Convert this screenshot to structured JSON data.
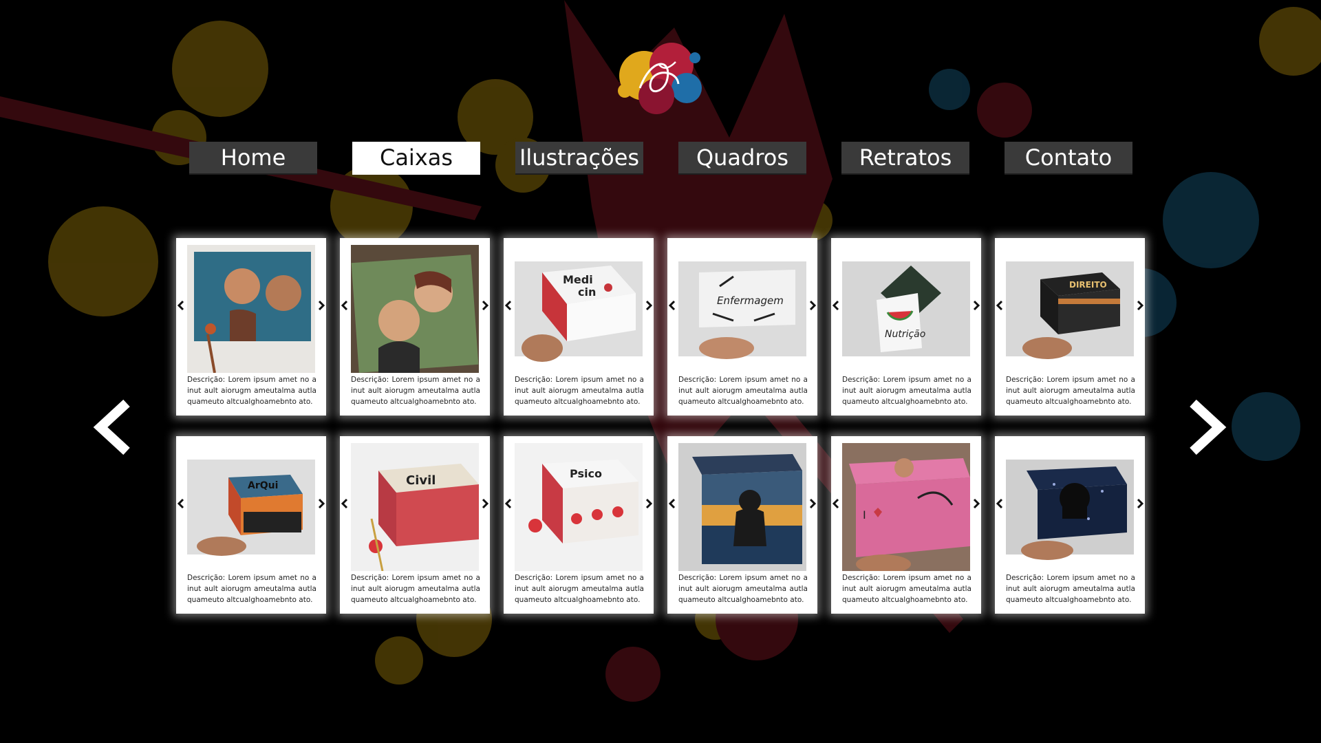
{
  "brand": {
    "logo_icon": "paint-splash-signature-logo"
  },
  "nav": {
    "items": [
      {
        "label": "Home",
        "active": false
      },
      {
        "label": "Caixas",
        "active": true
      },
      {
        "label": "Ilustrações",
        "active": false
      },
      {
        "label": "Quadros",
        "active": false
      },
      {
        "label": "Retratos",
        "active": false
      },
      {
        "label": "Contato",
        "active": false
      }
    ]
  },
  "gallery": {
    "cards": [
      {
        "image": "couple-portrait-box-photo",
        "description": "Descrição: Lorem ipsum amet no a inut ault aiorugm ameutalma autla quameuto altcualghoamebnto ato."
      },
      {
        "image": "elderly-couple-portrait-box-photo",
        "description": "Descrição: Lorem ipsum amet no a inut ault aiorugm ameutalma autla quameuto altcualghoamebnto ato."
      },
      {
        "image": "medicina-box-photo",
        "description": "Descrição: Lorem ipsum amet no a inut ault aiorugm ameutalma autla quameuto altcualghoamebnto ato."
      },
      {
        "image": "enfermagem-box-photo",
        "description": "Descrição: Lorem ipsum amet no a inut ault aiorugm ameutalma autla quameuto altcualghoamebnto ato."
      },
      {
        "image": "nutricao-box-photo",
        "description": "Descrição: Lorem ipsum amet no a inut ault aiorugm ameutalma autla quameuto altcualghoamebnto ato."
      },
      {
        "image": "direito-box-photo",
        "description": "Descrição: Lorem ipsum amet no a inut ault aiorugm ameutalma autla quameuto altcualghoamebnto ato."
      },
      {
        "image": "arquitetura-box-photo",
        "description": "Descrição: Lorem ipsum amet no a inut ault aiorugm ameutalma autla quameuto altcualghoamebnto ato."
      },
      {
        "image": "civil-box-photo",
        "description": "Descrição: Lorem ipsum amet no a inut ault aiorugm ameutalma autla quameuto altcualghoamebnto ato."
      },
      {
        "image": "psicologia-box-photo",
        "description": "Descrição: Lorem ipsum amet no a inut ault aiorugm ameutalma autla quameuto altcualghoamebnto ato."
      },
      {
        "image": "sunset-couple-box-photo",
        "description": "Descrição: Lorem ipsum amet no a inut ault aiorugm ameutalma autla quameuto altcualghoamebnto ato."
      },
      {
        "image": "pink-portrait-box-photo",
        "description": "Descrição: Lorem ipsum amet no a inut ault aiorugm ameutalma autla quameuto altcualghoamebnto ato."
      },
      {
        "image": "darth-vader-box-photo",
        "description": "Descrição: Lorem ipsum amet no a inut ault aiorugm ameutalma autla quameuto altcualghoamebnto ato."
      }
    ]
  },
  "icons": {
    "carousel_prev": "chevron-left-icon",
    "carousel_next": "chevron-right-icon",
    "card_prev": "small-chevron-left-icon",
    "card_next": "small-chevron-right-icon"
  },
  "colors": {
    "background": "#000000",
    "nav_inactive": "#3a3a3a",
    "nav_active": "#ffffff",
    "splash_yellow": "#4a3a05",
    "splash_red": "#3a0a10",
    "splash_blue": "#0b2a3a"
  }
}
